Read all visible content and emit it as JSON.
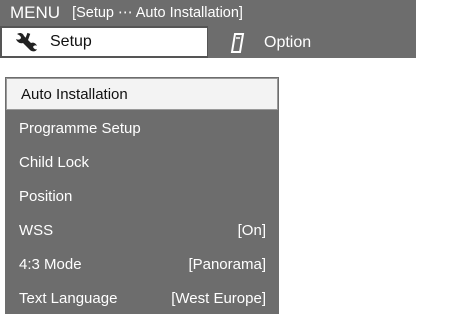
{
  "titlebar": {
    "menu": "MENU",
    "breadcrumb": "[Setup ⋯ Auto Installation]"
  },
  "tabs": [
    {
      "label": "Setup",
      "icon": "wrench-icon",
      "active": true
    },
    {
      "label": "Option",
      "icon": "remote-icon",
      "active": false
    }
  ],
  "menu": {
    "items": [
      {
        "label": "Auto Installation",
        "value": ""
      },
      {
        "label": "Programme Setup",
        "value": ""
      },
      {
        "label": "Child Lock",
        "value": ""
      },
      {
        "label": "Position",
        "value": ""
      },
      {
        "label": "WSS",
        "value": "[On]"
      },
      {
        "label": "4:3 Mode",
        "value": "[Panorama]"
      },
      {
        "label": "Text Language",
        "value": "[West Europe]"
      }
    ],
    "selected_index": 0
  },
  "colors": {
    "panel": "#6d6d6d",
    "selected_bg": "#f3f3f3",
    "text_light": "#ffffff",
    "text_dark": "#111111"
  }
}
